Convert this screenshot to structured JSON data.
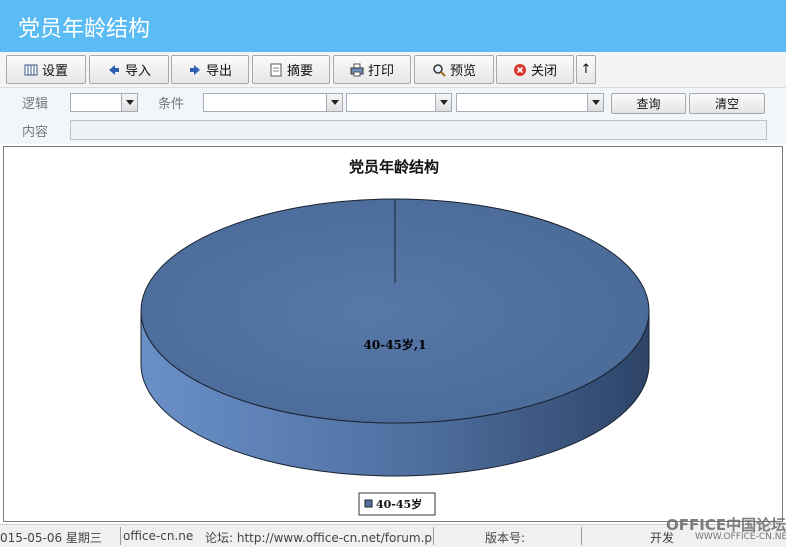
{
  "window": {
    "title": "党员年龄结构"
  },
  "toolbar": {
    "buttons": [
      {
        "label": "设置",
        "icon": "settings-icon"
      },
      {
        "label": "导入",
        "icon": "import-arrow-icon"
      },
      {
        "label": "导出",
        "icon": "export-arrow-icon"
      },
      {
        "label": "摘要",
        "icon": "summary-icon"
      },
      {
        "label": "打印",
        "icon": "printer-icon"
      },
      {
        "label": "预览",
        "icon": "magnifier-icon"
      },
      {
        "label": "关闭",
        "icon": "close-icon"
      }
    ],
    "up_arrow": "↑"
  },
  "filter": {
    "logic_label": "逻辑",
    "condition_label": "条件",
    "content_label": "内容",
    "logic_value": "",
    "field_value": "",
    "operator_value": "",
    "value_value": "",
    "content_value": "",
    "query_button": "查询",
    "clear_button": "清空"
  },
  "chart_data": {
    "type": "pie",
    "title": "党员年龄结构",
    "labels": [
      "40-45岁"
    ],
    "values": [
      1
    ],
    "data_labels": [
      "40-45岁,1"
    ],
    "legend": [
      "40-45岁"
    ],
    "legend_position": "bottom",
    "colors": [
      "#4f71a0"
    ]
  },
  "statusbar": {
    "date": "015-05-06 星期三",
    "website": "office-cn.net/",
    "forum": "论坛: http://www.office-cn.net/forum.ph",
    "version_label": "版本号:",
    "dev_text": "开发"
  },
  "watermark": {
    "main": "OFFICE中国论坛",
    "sub": "WWW.OFFICE-CN.NET"
  },
  "colors": {
    "header": "#5bbcf5",
    "pie": "#4f71a0",
    "filter_bg": "#f2f6fb"
  }
}
